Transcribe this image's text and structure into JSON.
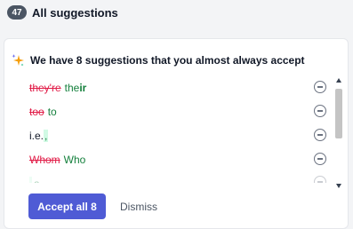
{
  "header": {
    "count": "47",
    "title": "All suggestions"
  },
  "card": {
    "title": "We have 8 suggestions that you almost always accept",
    "items": [
      {
        "old": "they're",
        "new_prefix": "the",
        "new_bold": "ir"
      },
      {
        "old": "too",
        "new": "to"
      },
      {
        "text": "i.e.",
        "added": ","
      },
      {
        "old": "Whom",
        "new": "Who"
      },
      {
        "new": "a"
      }
    ],
    "accept_label": "Accept all 8",
    "dismiss_label": "Dismiss"
  },
  "colors": {
    "accent": "#4f5bd5",
    "removed": "#e11d48",
    "added": "#15803d"
  }
}
